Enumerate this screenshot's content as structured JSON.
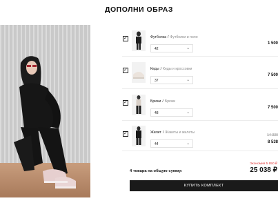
{
  "page": {
    "title": "ДОПОЛНИ ОБРАЗ"
  },
  "items": [
    {
      "name": "Футболка",
      "category": "Футболки и поло",
      "size": "42",
      "price": "1 500"
    },
    {
      "name": "Кеды",
      "category": "Кеды и кроссовки",
      "size": "37",
      "price": "7 500"
    },
    {
      "name": "Брюки",
      "category": "Брюки",
      "size": "48",
      "price": "7 500"
    },
    {
      "name": "Жилет",
      "category": "Жакеты и жилеты",
      "size": "44",
      "old_price": "14 330",
      "price": "8 538"
    }
  ],
  "summary": {
    "savings": "Экономия 5 650 ₽",
    "total_label": "4 товара на общую сумму:",
    "total_sum": "25 038 ₽",
    "buy_button": "КУПИТЬ КОМПЛЕКТ"
  },
  "icons": {
    "check": "checkmark-icon",
    "dropdown": "chevron-down-icon"
  },
  "colors": {
    "accent": "#1a1a1a",
    "savings": "#e23a3a"
  }
}
